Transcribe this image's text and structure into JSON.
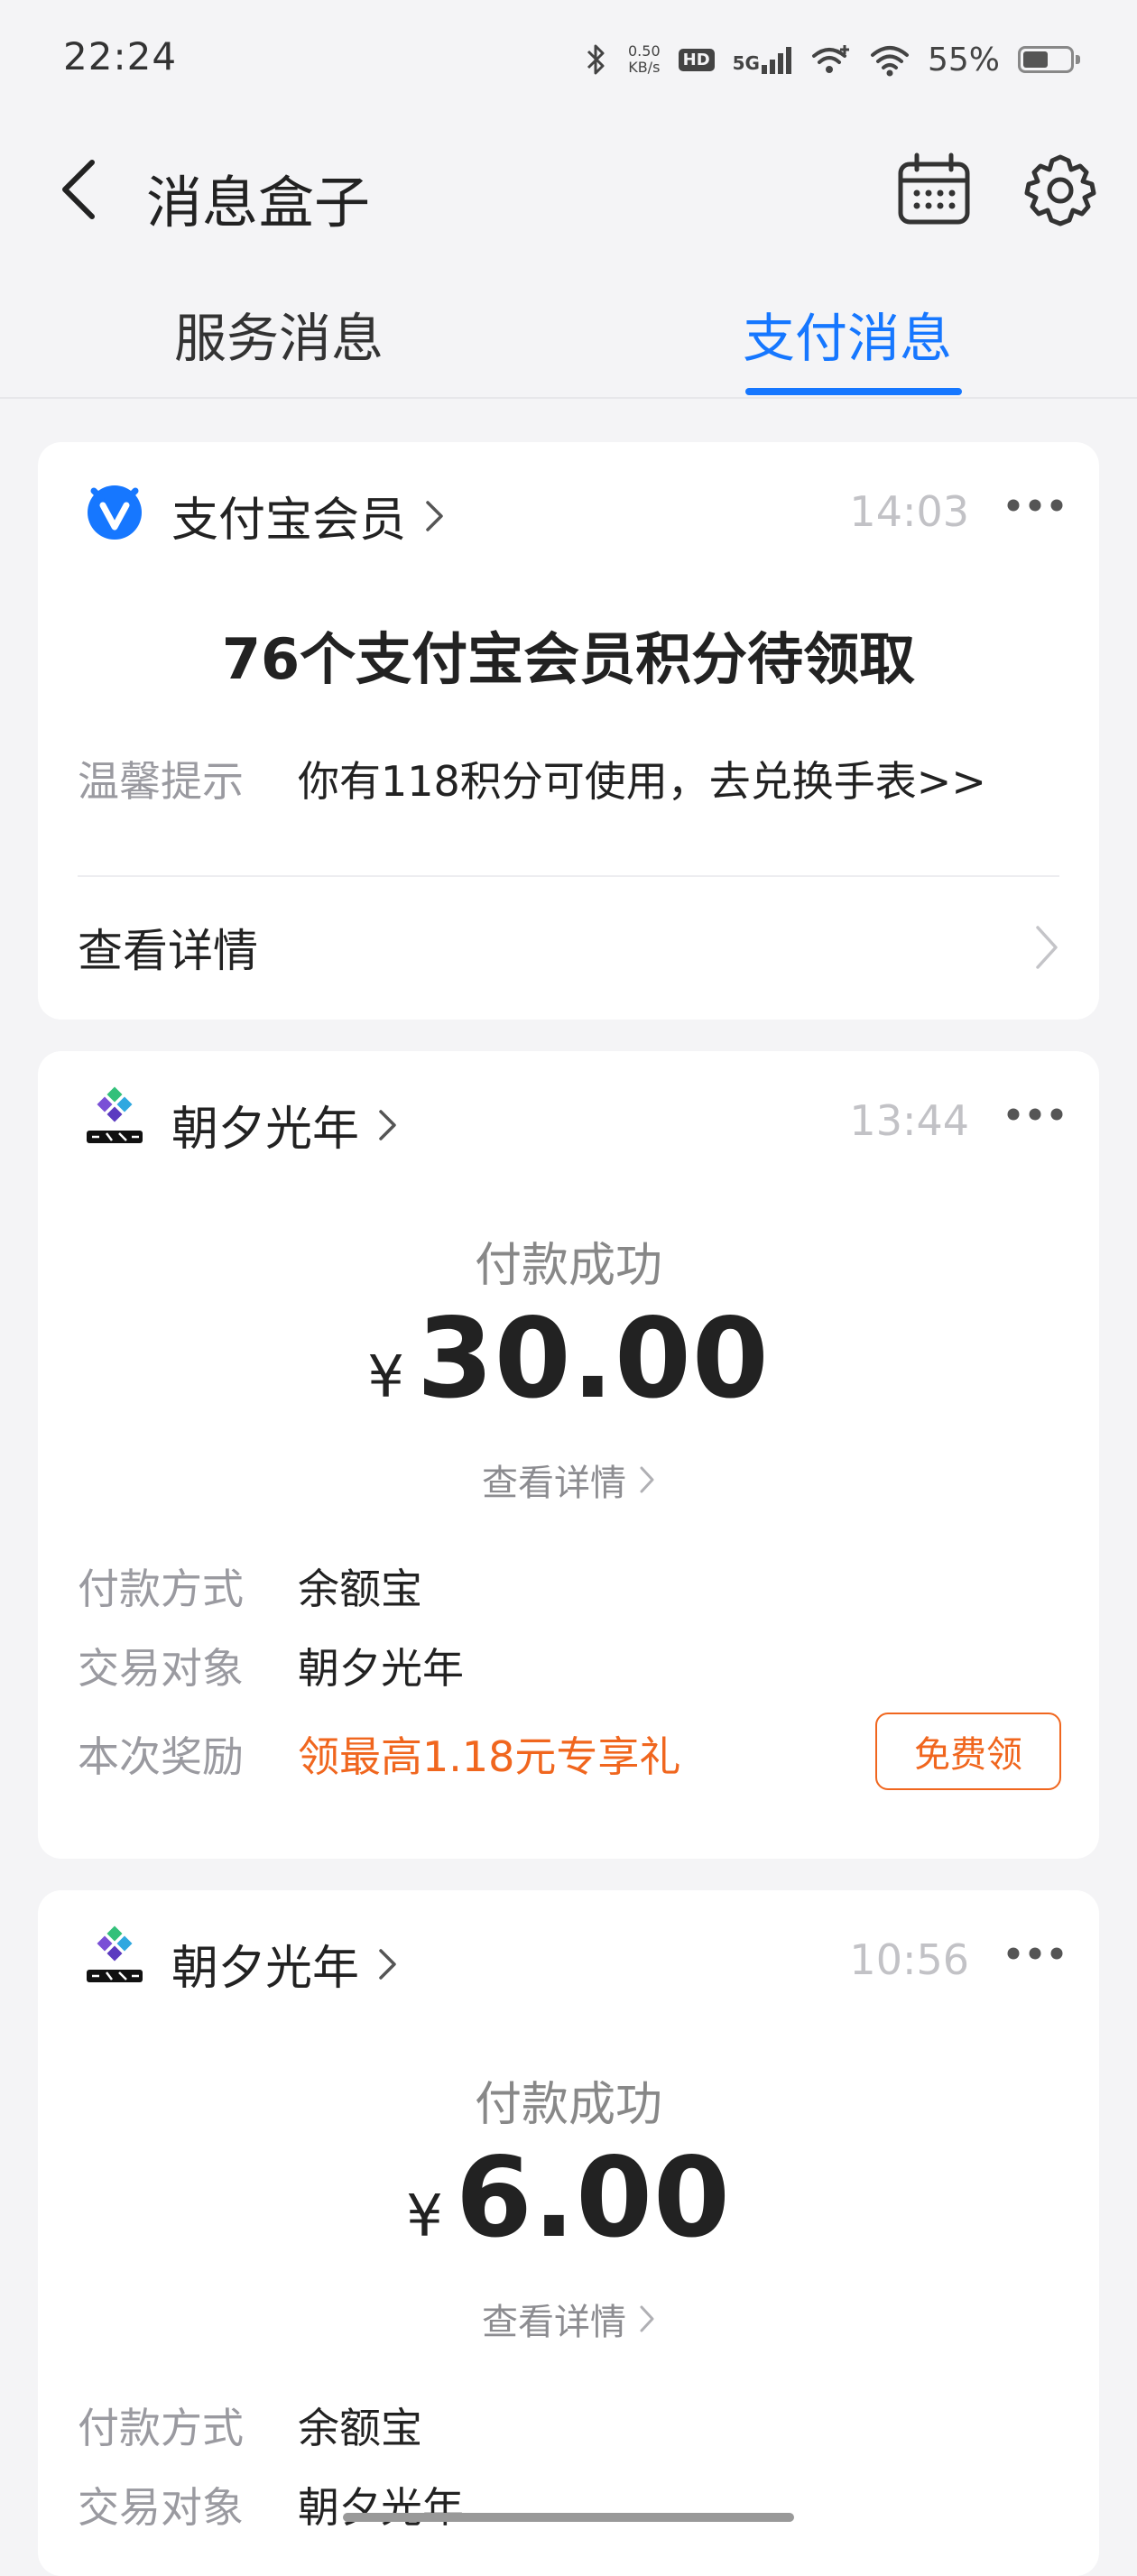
{
  "status_bar": {
    "time": "22:24",
    "net_speed_value": "0.50",
    "net_speed_unit": "KB/s",
    "hd_label": "HD",
    "network_gen": "5G",
    "battery_percent": "55%",
    "battery_level": 0.55
  },
  "header": {
    "title": "消息盒子"
  },
  "tabs": [
    {
      "label": "服务消息",
      "active": false
    },
    {
      "label": "支付消息",
      "active": true
    }
  ],
  "messages": [
    {
      "sender": "支付宝会员",
      "time": "14:03",
      "headline": "76个支付宝会员积分待领取",
      "tip_label": "温馨提示",
      "tip_value": "你有118积分可使用，去兑换手表>>",
      "view_label": "查看详情"
    },
    {
      "sender": "朝夕光年",
      "time": "13:44",
      "status": "付款成功",
      "currency": "¥",
      "amount": "30.00",
      "detail_link": "查看详情",
      "fields": [
        {
          "label": "付款方式",
          "value": "余额宝"
        },
        {
          "label": "交易对象",
          "value": "朝夕光年"
        },
        {
          "label": "本次奖励",
          "value": "领最高1.18元专享礼"
        }
      ],
      "reward_button": "免费领"
    },
    {
      "sender": "朝夕光年",
      "time": "10:56",
      "status": "付款成功",
      "currency": "¥",
      "amount": "6.00",
      "detail_link": "查看详情",
      "fields": [
        {
          "label": "付款方式",
          "value": "余额宝"
        },
        {
          "label": "交易对象",
          "value": "朝夕光年"
        }
      ]
    }
  ],
  "colors": {
    "accent": "#1677ff",
    "reward": "#f0661e",
    "background": "#f4f4f6"
  },
  "icons": {
    "back": "back-arrow-icon",
    "calendar": "calendar-icon",
    "settings": "gear-icon",
    "more": "more-dots-icon",
    "alipay_member_logo": "alipay-member-logo",
    "zhaoxi_logo": "zhaoxi-guangnian-logo"
  }
}
